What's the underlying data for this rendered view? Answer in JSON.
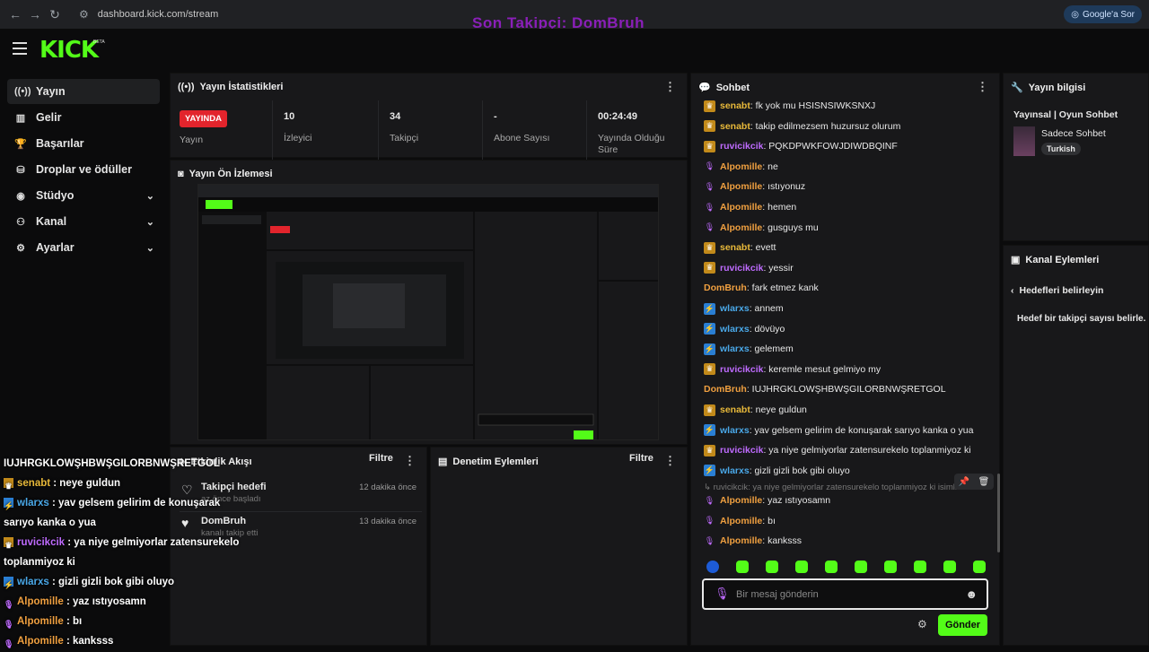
{
  "browser": {
    "url": "dashboard.kick.com/stream",
    "google_btn": "Google'a Sor"
  },
  "overlay": {
    "follower_text": "Son Takipçi: DomBruh",
    "chat": [
      {
        "user": "",
        "msg": "IUJHRGKLOWŞHBWŞGILORBNWŞRETGOL",
        "color": "#ffffff",
        "badge": ""
      },
      {
        "user": "senabt",
        "msg": " : neye guldun",
        "color": "#e8b93a",
        "badge": "crown"
      },
      {
        "user": "wlarxs",
        "msg": " : yav gelsem gelirim de konuşarak",
        "color": "#4aa8e8",
        "badge": "bolt"
      },
      {
        "user": "",
        "msg": "sarıyo kanka o yua",
        "color": "#ffffff",
        "badge": ""
      },
      {
        "user": "ruvicikcik",
        "msg": " : ya niye gelmiyorlar zatensurekelo",
        "color": "#bf6bff",
        "badge": "crown"
      },
      {
        "user": "",
        "msg": "toplanmiyoz ki",
        "color": "#ffffff",
        "badge": ""
      },
      {
        "user": "wlarxs",
        "msg": " : gizli gizli bok gibi oluyo",
        "color": "#4aa8e8",
        "badge": "bolt"
      },
      {
        "user": "Alpomille",
        "msg": " : yaz ıstıyosamn",
        "color": "#f0a040",
        "badge": "mic"
      },
      {
        "user": "Alpomille",
        "msg": " : bı",
        "color": "#f0a040",
        "badge": "mic"
      },
      {
        "user": "Alpomille",
        "msg": " : kanksss",
        "color": "#f0a040",
        "badge": "mic"
      }
    ]
  },
  "header": {
    "logo": "KICK",
    "beta": "BETA"
  },
  "sidebar": {
    "items": [
      {
        "label": "Yayın",
        "icon": "live-icon",
        "glyph": "((•))",
        "chev": false
      },
      {
        "label": "Gelir",
        "icon": "revenue-icon",
        "glyph": "▥",
        "chev": false
      },
      {
        "label": "Başarılar",
        "icon": "trophy-icon",
        "glyph": "🏆",
        "chev": false
      },
      {
        "label": "Droplar ve ödüller",
        "icon": "drops-icon",
        "glyph": "⛁",
        "chev": false
      },
      {
        "label": "Stüdyo",
        "icon": "studio-icon",
        "glyph": "◉",
        "chev": true
      },
      {
        "label": "Kanal",
        "icon": "channel-icon",
        "glyph": "⚇",
        "chev": true
      },
      {
        "label": "Ayarlar",
        "icon": "settings-icon",
        "glyph": "⚙",
        "chev": true
      }
    ]
  },
  "stats": {
    "title": "Yayın İstatistikleri",
    "live_badge": "YAYINDA",
    "live_label": "Yayın",
    "cells": [
      {
        "value": "10",
        "label": "İzleyici"
      },
      {
        "value": "34",
        "label": "Takipçi"
      },
      {
        "value": "-",
        "label": "Abone Sayısı"
      },
      {
        "value": "00:24:49",
        "label": "Yayında Olduğu Süre"
      }
    ]
  },
  "preview": {
    "title": "Yayın Ön İzlemesi"
  },
  "activity": {
    "title": "Etkinlik Akışı",
    "filter": "Filtre",
    "items": [
      {
        "title": "Takipçi hedefi",
        "sub": "az önce başladı",
        "time": "12 dakika önce"
      },
      {
        "title": "DomBruh",
        "sub": "kanalı takip etti",
        "time": "13 dakika önce"
      }
    ]
  },
  "moderation": {
    "title": "Denetim Eylemleri",
    "filter": "Filtre"
  },
  "chat": {
    "title": "Sohbet",
    "messages": [
      {
        "user": "senabt",
        "msg": ": fk yok mu HSISNSIWKSNXJ",
        "color": "#e8b93a",
        "badge": "crown"
      },
      {
        "user": "senabt",
        "msg": ": takip edilmezsem huzursuz olurum",
        "color": "#e8b93a",
        "badge": "crown"
      },
      {
        "user": "ruvicikcik",
        "msg": ": PQKDPWKFOWJDIWDBQINF",
        "color": "#bf6bff",
        "badge": "crown"
      },
      {
        "user": "Alpomille",
        "msg": ": ne",
        "color": "#f0a040",
        "badge": "mic"
      },
      {
        "user": "Alpomille",
        "msg": ": ıstıyonuz",
        "color": "#f0a040",
        "badge": "mic"
      },
      {
        "user": "Alpomille",
        "msg": ": hemen",
        "color": "#f0a040",
        "badge": "mic"
      },
      {
        "user": "Alpomille",
        "msg": ": gusguys mu",
        "color": "#f0a040",
        "badge": "mic"
      },
      {
        "user": "senabt",
        "msg": ": evett",
        "color": "#e8b93a",
        "badge": "crown"
      },
      {
        "user": "ruvicikcik",
        "msg": ": yessir",
        "color": "#bf6bff",
        "badge": "crown"
      },
      {
        "user": "DomBruh",
        "msg": ": fark etmez kank",
        "color": "#f0a040",
        "badge": ""
      },
      {
        "user": "wlarxs",
        "msg": ": annem",
        "color": "#4aa8e8",
        "badge": "bolt"
      },
      {
        "user": "wlarxs",
        "msg": ": dövüyo",
        "color": "#4aa8e8",
        "badge": "bolt"
      },
      {
        "user": "wlarxs",
        "msg": ": gelemem",
        "color": "#4aa8e8",
        "badge": "bolt"
      },
      {
        "user": "ruvicikcik",
        "msg": ": keremle mesut gelmiyo my",
        "color": "#bf6bff",
        "badge": "crown"
      },
      {
        "user": "DomBruh",
        "msg": ": IUJHRGKLOWŞHBWŞGILORBNWŞRETGOL",
        "color": "#f0a040",
        "badge": ""
      },
      {
        "user": "senabt",
        "msg": ": neye guldun",
        "color": "#e8b93a",
        "badge": "crown"
      },
      {
        "user": "wlarxs",
        "msg": ": yav gelsem gelirim de konuşarak sarıyo kanka o yua",
        "color": "#4aa8e8",
        "badge": "bolt"
      },
      {
        "user": "ruvicikcik",
        "msg": ": ya niye gelmiyorlar zatensurekelo toplanmiyoz ki",
        "color": "#bf6bff",
        "badge": "crown"
      },
      {
        "user": "wlarxs",
        "msg": ": gizli gizli bok gibi oluyo",
        "color": "#4aa8e8",
        "badge": "bolt"
      }
    ],
    "reply_preview": "↳ ruvicikcik: ya niye gelmiyorlar zatensurekelo toplanmiyoz ki isimli k",
    "messages_after": [
      {
        "user": "Alpomille",
        "msg": ": yaz ıstıyosamn",
        "color": "#f0a040",
        "badge": "mic"
      },
      {
        "user": "Alpomille",
        "msg": ": bı",
        "color": "#f0a040",
        "badge": "mic"
      },
      {
        "user": "Alpomille",
        "msg": ": kanksss",
        "color": "#f0a040",
        "badge": "mic"
      }
    ],
    "input_placeholder": "Bir mesaj gönderin",
    "send_label": "Gönder"
  },
  "stream_info": {
    "title": "Yayın bilgisi",
    "stream_title": "Yayınsal | Oyun Sohbet",
    "category": "Sadece Sohbet",
    "tag": "Turkish"
  },
  "channel_actions": {
    "title": "Kanal Eylemleri",
    "back_label": "Hedefleri belirleyin",
    "desc": "Hedef bir takipçi sayısı belirle."
  },
  "colors": {
    "accent": "#53fc18",
    "live": "#e2242c",
    "panel": "#18181a"
  }
}
